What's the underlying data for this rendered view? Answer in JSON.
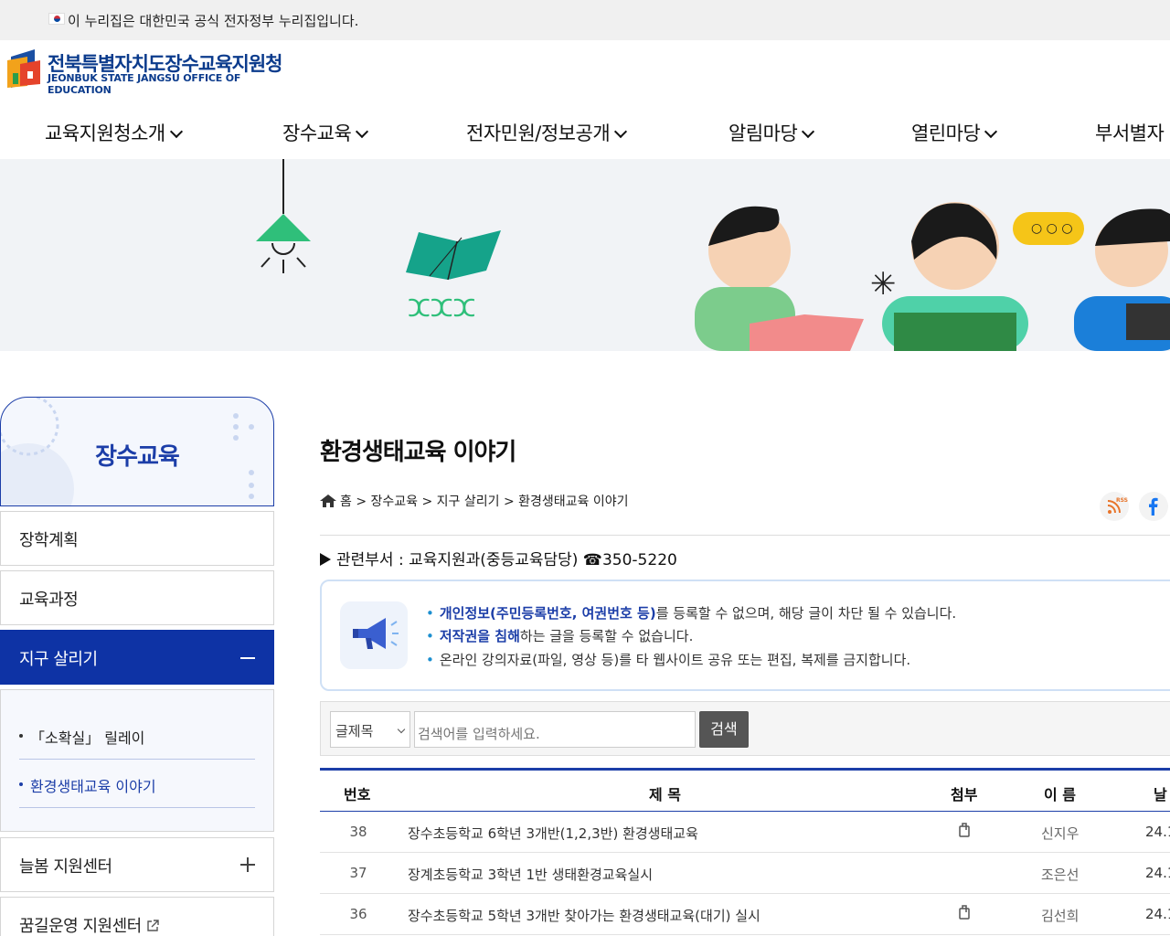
{
  "gov_banner": {
    "text": "이 누리집은 대한민국 공식 전자정부 누리집입니다."
  },
  "logo": {
    "name_kr": "전북특별자치도장수교육지원청",
    "name_en": "JEONBUK STATE JANGSU OFFICE OF EDUCATION"
  },
  "gnb": [
    "교육지원청소개",
    "장수교육",
    "전자민원/정보공개",
    "알림마당",
    "열린마당",
    "부서별자"
  ],
  "sidebar": {
    "title": "장수교육",
    "items": [
      "장학계획",
      "교육과정",
      "지구 살리기",
      "늘봄 지원센터",
      "꿈길운영 지원센터"
    ],
    "sub_items": [
      "「소확실」 릴레이",
      "환경생태교육 이야기"
    ]
  },
  "content": {
    "title": "환경생태교육 이야기",
    "breadcrumb": "홈 > 장수교육 > 지구 살리기 > 환경생태교육 이야기",
    "rss_label": "RSS",
    "dept": "관련부서 : 교육지원과(중등교육담당) ☎350-5220",
    "notices": [
      {
        "hl": "개인정보(주민등록번호, 여권번호 등)",
        "rest": "를 등록할 수 없으며, 해당 글이 차단 될 수 있습니다."
      },
      {
        "hl": "저작권을 침해",
        "rest": "하는 글을 등록할 수 없습니다."
      },
      {
        "hl": "",
        "rest": "온라인 강의자료(파일, 영상 등)를 타 웹사이트 공유 또는 편집, 복제를 금지합니다."
      }
    ],
    "search": {
      "select_value": "글제목",
      "placeholder": "검색어를 입력하세요.",
      "button": "검색"
    },
    "table": {
      "headers": [
        "번호",
        "제 목",
        "첨부",
        "이 름",
        "날"
      ],
      "rows": [
        {
          "num": "38",
          "title": "장수초등학교 6학년 3개반(1,2,3반) 환경생태교육",
          "attach": true,
          "name": "신지우",
          "date": "24.1"
        },
        {
          "num": "37",
          "title": "장계초등학교 3학년 1반 생태환경교육실시",
          "attach": false,
          "name": "조은선",
          "date": "24.1"
        },
        {
          "num": "36",
          "title": "장수초등학교 5학년 3개반 찾아가는 환경생태교육(대기) 실시",
          "attach": true,
          "name": "김선희",
          "date": "24.1"
        }
      ]
    }
  }
}
